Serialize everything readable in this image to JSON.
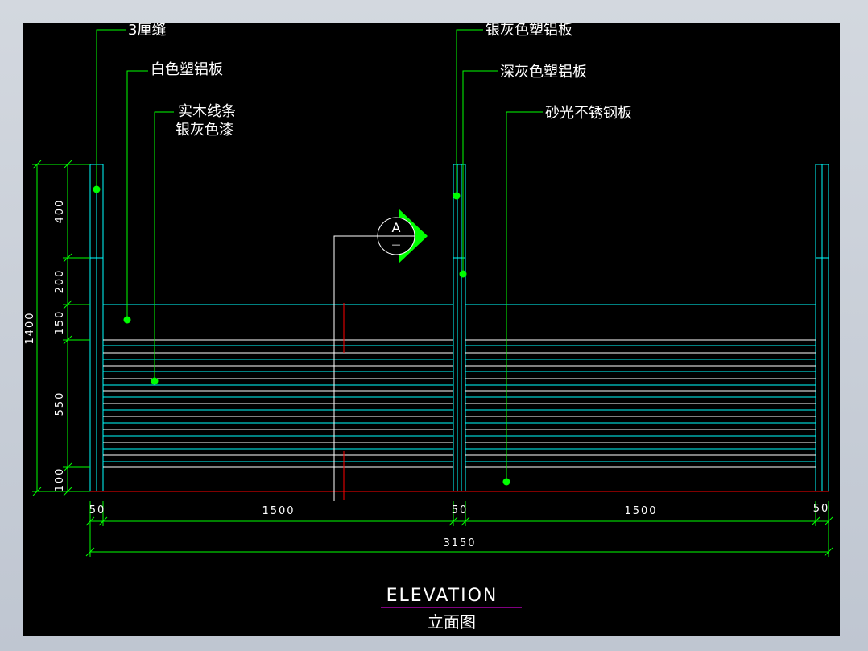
{
  "colors": {
    "background": "#000000",
    "frame": "#c6ccd6",
    "leader": "#00ff00",
    "outline": "#00ffff",
    "ground_line": "#ff0000",
    "text": "#ffffff",
    "title_underline": "#ff00ff",
    "dimension": "#00ff00"
  },
  "callouts": {
    "left": [
      {
        "label": "3厘缝"
      },
      {
        "label": "白色塑铝板"
      },
      {
        "label": "实木线条",
        "label2": "银灰色漆"
      }
    ],
    "right": [
      {
        "label": "银灰色塑铝板"
      },
      {
        "label": "深灰色塑铝板"
      },
      {
        "label": "砂光不锈钢板"
      }
    ]
  },
  "section_marker": {
    "letter": "A",
    "sub": "—"
  },
  "dimensions": {
    "vertical": [
      "400",
      "200",
      "150",
      "550",
      "100"
    ],
    "vertical_total": "1400",
    "horizontal": [
      "50",
      "1500",
      "50",
      "1500",
      "50"
    ],
    "horizontal_total": "3150"
  },
  "title": {
    "en": "ELEVATION",
    "cn": "立面图"
  }
}
